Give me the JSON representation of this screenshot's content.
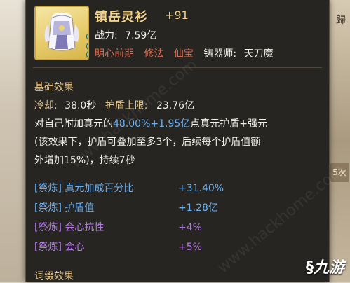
{
  "item": {
    "name": "镇岳灵衫",
    "enhance": "+91",
    "power_label": "战力:",
    "power_value": "7.59亿",
    "tags": [
      "明心前期",
      "修法",
      "仙宝"
    ],
    "smith_label": "铸器师:",
    "smith_name": "天刀魔"
  },
  "basic": {
    "title": "基础效果",
    "cooldown_label": "冷却:",
    "cooldown_value": "38.0秒",
    "shield_cap_label": "护盾上限:",
    "shield_cap_value": "23.76亿",
    "desc1_a": "对自己附加真元的",
    "desc1_pct": "48.00%+1.95亿",
    "desc1_b": "点真元护盾+强元",
    "desc2": "(该效果下，护盾可叠加至多3个，后续每个护盾值额",
    "desc3": "外增加15%)，持续7秒"
  },
  "refine_stats": [
    {
      "tag": "[祭炼]",
      "name": "真元加成百分比",
      "value": "+31.40%",
      "color": "#6fb0ef"
    },
    {
      "tag": "[祭炼]",
      "name": "护盾值",
      "value": "+1.28亿",
      "color": "#6fb0ef"
    },
    {
      "tag": "[祭炼]",
      "name": "会心抗性",
      "value": "+4%",
      "color": "#b57ae8"
    },
    {
      "tag": "[祭炼]",
      "name": "会心",
      "value": "+5%",
      "color": "#b57ae8"
    }
  ],
  "affix": {
    "title": "词缀效果"
  },
  "side": {
    "chip": "5次",
    "glyph": "歸"
  },
  "watermark": "www.hackhome.com",
  "logo": "九游"
}
